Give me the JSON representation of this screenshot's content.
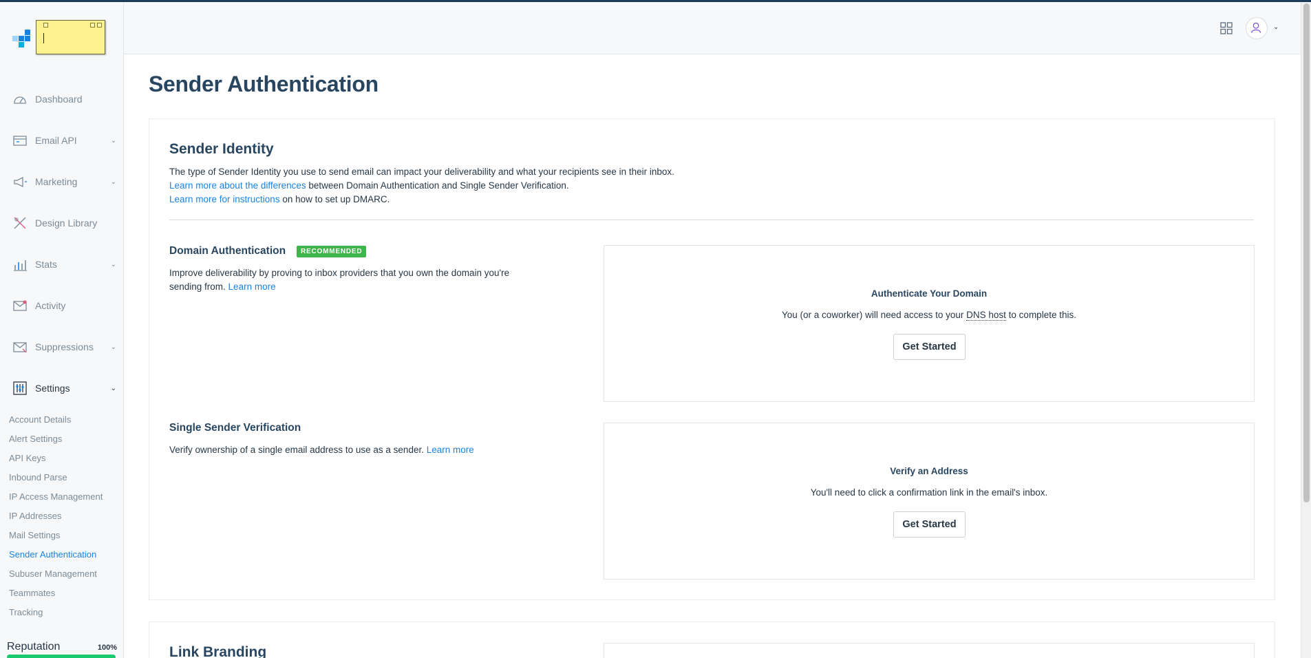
{
  "sidebar": {
    "nav": [
      {
        "label": "Dashboard",
        "icon": "dashboard-gauge-icon",
        "chevron": false
      },
      {
        "label": "Email API",
        "icon": "email-api-icon",
        "chevron": true
      },
      {
        "label": "Marketing",
        "icon": "megaphone-icon",
        "chevron": true
      },
      {
        "label": "Design Library",
        "icon": "design-tools-icon",
        "chevron": false
      },
      {
        "label": "Stats",
        "icon": "bar-chart-icon",
        "chevron": true
      },
      {
        "label": "Activity",
        "icon": "activity-envelope-icon",
        "chevron": false
      },
      {
        "label": "Suppressions",
        "icon": "suppressions-icon",
        "chevron": true
      },
      {
        "label": "Settings",
        "icon": "settings-sliders-icon",
        "chevron": true
      }
    ],
    "settings_items": [
      "Account Details",
      "Alert Settings",
      "API Keys",
      "Inbound Parse",
      "IP Access Management",
      "IP Addresses",
      "Mail Settings",
      "Sender Authentication",
      "Subuser Management",
      "Teammates",
      "Tracking"
    ],
    "current_item": "Sender Authentication",
    "reputation": {
      "label": "Reputation",
      "value": "100%",
      "fraction": 1.0,
      "bar_color": "#18c96e"
    }
  },
  "header": {
    "apps_icon": "apps-grid-icon",
    "avatar_icon": "user-avatar-icon"
  },
  "page": {
    "title": "Sender Authentication",
    "sender_identity": {
      "title": "Sender Identity",
      "line1": "The type of Sender Identity you use to send email can impact your deliverability and what your recipients see in their inbox.",
      "line2_link": "Learn more about the differences",
      "line2_rest": " between Domain Authentication and Single Sender Verification.",
      "line3_link": "Learn more for instructions",
      "line3_rest": " on how to set up DMARC."
    },
    "domain_auth": {
      "title": "Domain Authentication",
      "badge": "RECOMMENDED",
      "desc_line1": "Improve deliverability by proving to inbox providers that you own the domain you're",
      "desc_line2": "sending from. ",
      "learn_more": "Learn more",
      "box_title": "Authenticate Your Domain",
      "box_desc_pre": "You (or a coworker) will need access to your ",
      "box_desc_dns": "DNS host",
      "box_desc_post": " to complete this.",
      "button": "Get Started"
    },
    "single_sender": {
      "title": "Single Sender Verification",
      "desc": "Verify ownership of a single email address to use as a sender. ",
      "learn_more": "Learn more",
      "box_title": "Verify an Address",
      "box_desc": "You'll need to click a confirmation link in the email's inbox.",
      "button": "Get Started"
    },
    "link_branding": {
      "title": "Link Branding"
    }
  },
  "colors": {
    "accent": "#1a82e2",
    "heading": "#294661",
    "badge": "#3db54a"
  }
}
